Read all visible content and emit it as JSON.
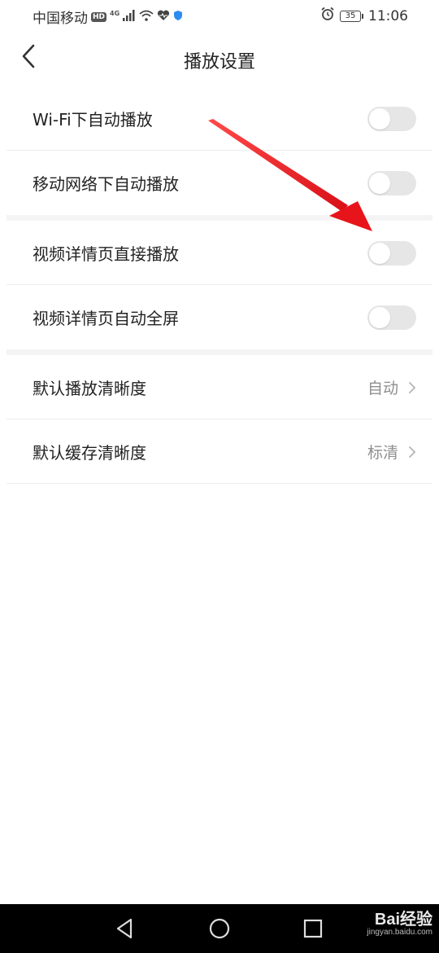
{
  "status_bar": {
    "carrier": "中国移动",
    "hd_badge": "HD",
    "network": "4G",
    "battery": "35",
    "time": "11:06"
  },
  "header": {
    "title": "播放设置",
    "back_icon": "chevron-left-icon"
  },
  "settings": {
    "wifi_autoplay": {
      "label": "Wi-Fi下自动播放",
      "enabled": false
    },
    "mobile_autoplay": {
      "label": "移动网络下自动播放",
      "enabled": false
    },
    "detail_direct_play": {
      "label": "视频详情页直接播放",
      "enabled": false
    },
    "detail_auto_fullscreen": {
      "label": "视频详情页自动全屏",
      "enabled": false
    },
    "default_play_quality": {
      "label": "默认播放清晰度",
      "value": "自动"
    },
    "default_cache_quality": {
      "label": "默认缓存清晰度",
      "value": "标清"
    }
  },
  "annotation": {
    "color": "#e8141b",
    "icon": "red-arrow"
  },
  "nav_bar": {
    "back_icon": "triangle-back-icon",
    "home_icon": "circle-home-icon",
    "recents_icon": "square-recents-icon"
  },
  "watermark": {
    "brand": "Bai经验",
    "url": "jingyan.baidu.com"
  }
}
